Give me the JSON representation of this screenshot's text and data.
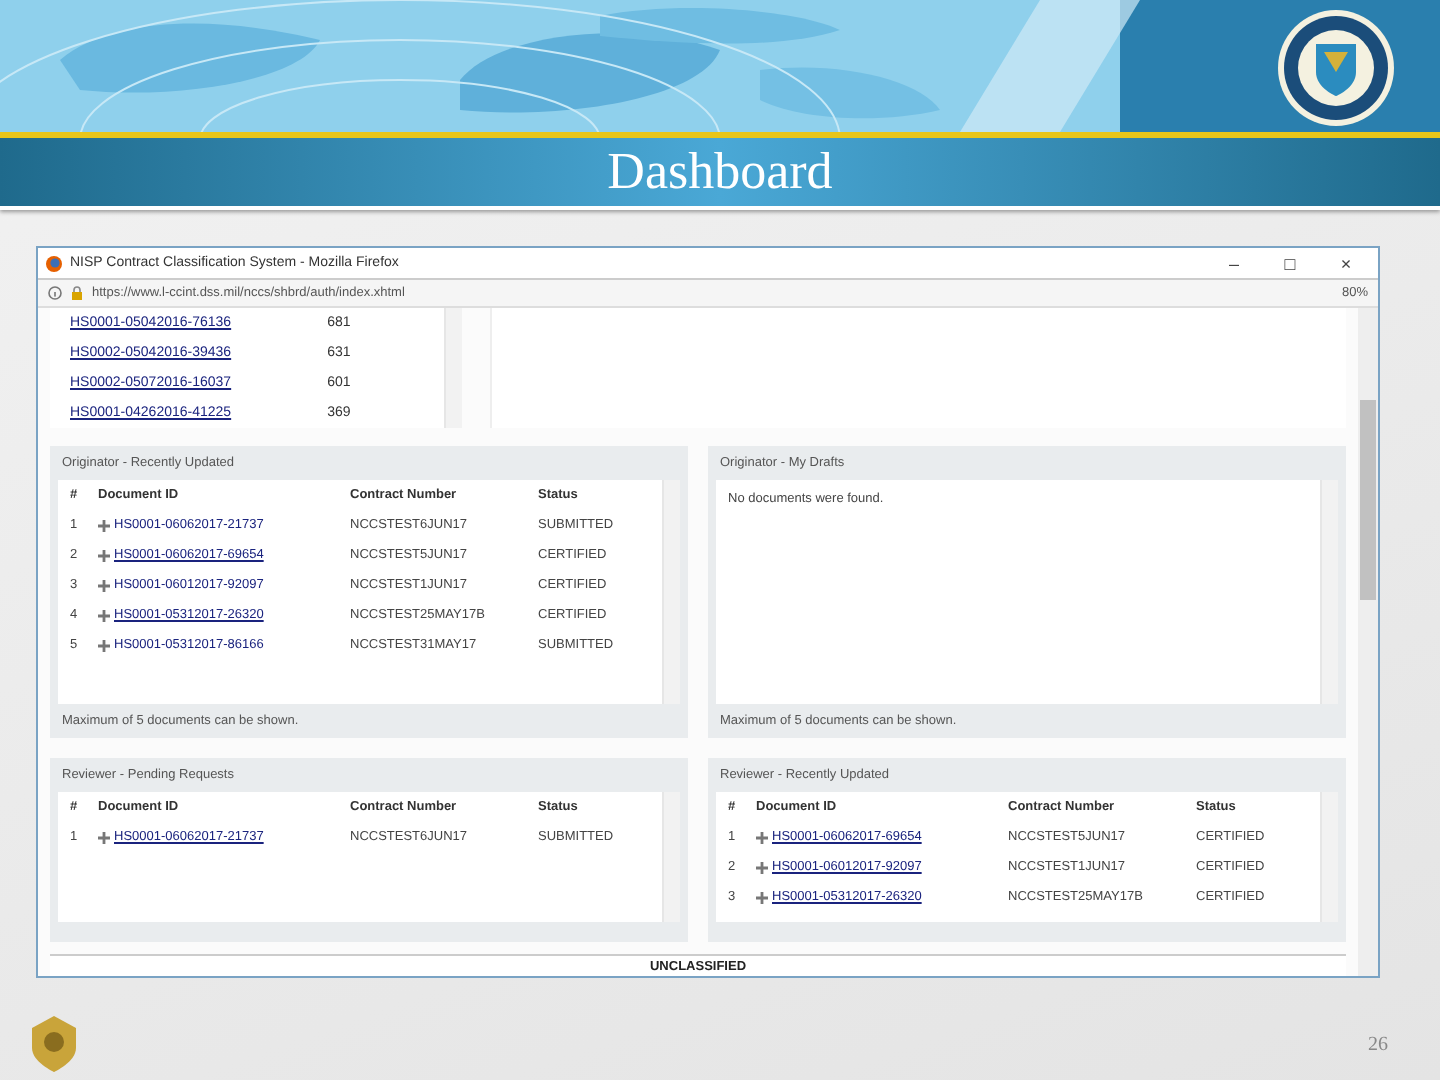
{
  "slide": {
    "title": "Dashboard",
    "page_number": "26"
  },
  "browser": {
    "title": "NISP Contract Classification System - Mozilla Firefox",
    "controls": [
      "–",
      "□",
      "×"
    ],
    "url": "https://www.l-ccint.dss.mil/nccs/shbrd/auth/index.xhtml",
    "zoom": "80%"
  },
  "top_table": {
    "rows": [
      {
        "id": "HS0001-05042016-76136",
        "value": "681"
      },
      {
        "id": "HS0002-05042016-39436",
        "value": "631"
      },
      {
        "id": "HS0002-05072016-16037",
        "value": "601"
      },
      {
        "id": "HS0001-04262016-41225",
        "value": "369"
      }
    ]
  },
  "panels": [
    {
      "title": "Originator - Recently Updated",
      "columns": [
        "#",
        "Document ID",
        "Contract Number",
        "Status"
      ],
      "rows": [
        {
          "n": "1",
          "id": "HS0001-06062017-21737",
          "contract": "NCCSTEST6JUN17",
          "status": "SUBMITTED",
          "underlined": false
        },
        {
          "n": "2",
          "id": "HS0001-06062017-69654",
          "contract": "NCCSTEST5JUN17",
          "status": "CERTIFIED",
          "underlined": true
        },
        {
          "n": "3",
          "id": "HS0001-06012017-92097",
          "contract": "NCCSTEST1JUN17",
          "status": "CERTIFIED",
          "underlined": false
        },
        {
          "n": "4",
          "id": "HS0001-05312017-26320",
          "contract": "NCCSTEST25MAY17B",
          "status": "CERTIFIED",
          "underlined": true
        },
        {
          "n": "5",
          "id": "HS0001-05312017-86166",
          "contract": "NCCSTEST31MAY17",
          "status": "SUBMITTED",
          "underlined": false
        }
      ],
      "footer": "Maximum of 5 documents can be shown."
    },
    {
      "title": "Originator - My Drafts",
      "message": "No documents were found.",
      "footer": "Maximum of 5 documents can be shown."
    },
    {
      "title": "Reviewer - Pending Requests",
      "columns": [
        "#",
        "Document ID",
        "Contract Number",
        "Status"
      ],
      "rows": [
        {
          "n": "1",
          "id": "HS0001-06062017-21737",
          "contract": "NCCSTEST6JUN17",
          "status": "SUBMITTED",
          "underlined": true
        }
      ]
    },
    {
      "title": "Reviewer - Recently Updated",
      "columns": [
        "#",
        "Document ID",
        "Contract Number",
        "Status"
      ],
      "rows": [
        {
          "n": "1",
          "id": "HS0001-06062017-69654",
          "contract": "NCCSTEST5JUN17",
          "status": "CERTIFIED",
          "underlined": true
        },
        {
          "n": "2",
          "id": "HS0001-06012017-92097",
          "contract": "NCCSTEST1JUN17",
          "status": "CERTIFIED",
          "underlined": true
        },
        {
          "n": "3",
          "id": "HS0001-05312017-26320",
          "contract": "NCCSTEST25MAY17B",
          "status": "CERTIFIED",
          "underlined": true
        }
      ]
    }
  ],
  "status_bar": "UNCLASSIFIED"
}
